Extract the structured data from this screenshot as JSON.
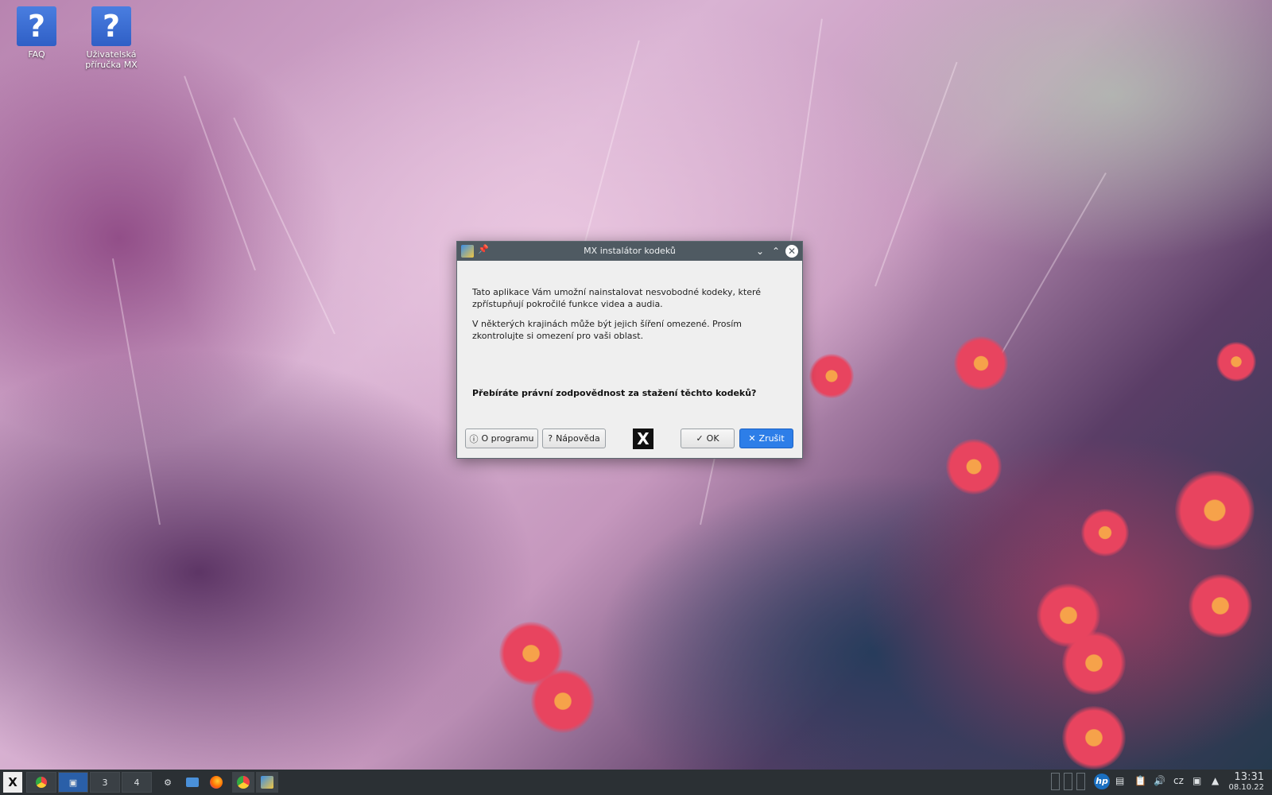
{
  "desktop": {
    "icons": [
      {
        "label": "FAQ",
        "glyph": "?"
      },
      {
        "label": "Uživatelská příručka MX",
        "glyph": "?"
      }
    ]
  },
  "dialog": {
    "title": "MX instalátor kodeků",
    "paragraph1": "Tato aplikace Vám umožní nainstalovat nesvobodné kodeky, které zpřístupňují pokročilé funkce videa a audia.",
    "paragraph2": "V některých krajinách může být jejich šíření omezené. Prosím zkontrolujte si omezení pro vaši oblast.",
    "question": "Přebíráte právní zodpovědnost za stažení těchto kodeků?",
    "buttons": {
      "about": "O programu",
      "help": "Nápověda",
      "ok": "OK",
      "cancel": "Zrušit"
    },
    "logo": "X"
  },
  "taskbar": {
    "start_logo": "X",
    "workspaces": [
      "",
      "",
      "3",
      "4"
    ],
    "keyboard_layout": "cz",
    "clock_time": "13:31",
    "clock_date": "08.10.22"
  }
}
